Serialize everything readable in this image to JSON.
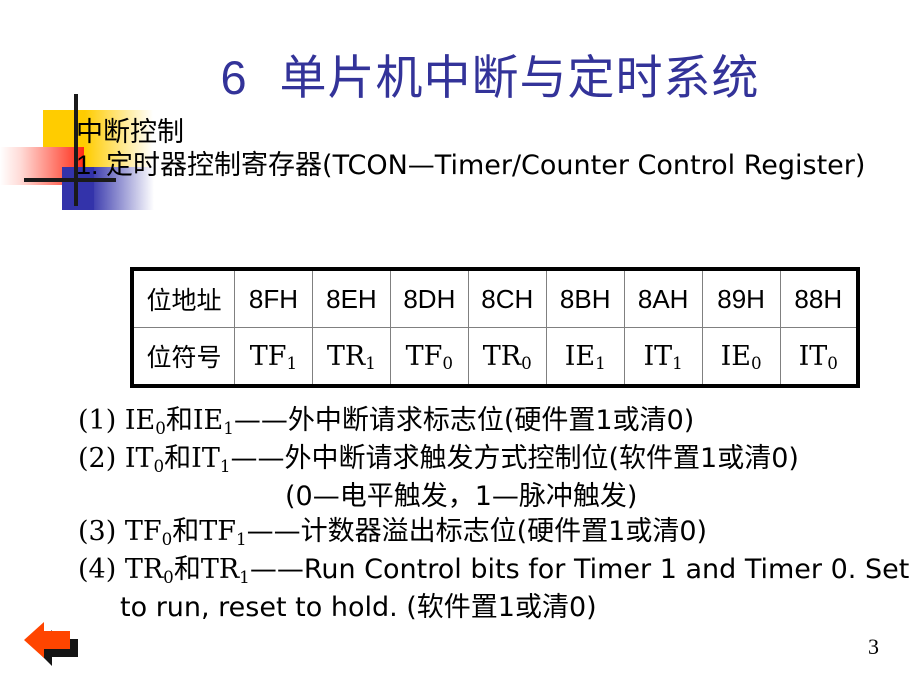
{
  "slide": {
    "title_number": "6",
    "title_text": "单片机中断与定时系统",
    "title_color": "#333399",
    "page_number": "3"
  },
  "heading": {
    "subheading": "中断控制",
    "item1_prefix": "1. ",
    "item1_text": "定时器控制寄存器(TCON—Timer/Counter Control Register)"
  },
  "table": {
    "row_label_address": "位地址",
    "row_label_symbol": "位符号",
    "addresses": [
      "8FH",
      "8EH",
      "8DH",
      "8CH",
      "8BH",
      "8AH",
      "89H",
      "88H"
    ],
    "symbols": [
      {
        "base": "TF",
        "sub": "1"
      },
      {
        "base": "TR",
        "sub": "1"
      },
      {
        "base": "TF",
        "sub": "0"
      },
      {
        "base": "TR",
        "sub": "0"
      },
      {
        "base": "IE",
        "sub": "1"
      },
      {
        "base": "IT",
        "sub": "1"
      },
      {
        "base": "IE",
        "sub": "0"
      },
      {
        "base": "IT",
        "sub": "0"
      }
    ]
  },
  "bullets": [
    {
      "id": "b1",
      "marker": "(1) ",
      "a_base": "IE",
      "a_sub": "0",
      "conj": "和",
      "b_base": "IE",
      "b_sub": "1",
      "desc": "——外中断请求标志位(硬件置1或清0)"
    },
    {
      "id": "b2",
      "marker": "(2) ",
      "a_base": "IT",
      "a_sub": "0",
      "conj": "和",
      "b_base": "IT",
      "b_sub": "1",
      "desc": "——外中断请求触发方式控制位(软件置1或清0)"
    },
    {
      "id": "b3",
      "note": "(0—电平触发，1—脉冲触发)"
    },
    {
      "id": "b4",
      "marker": "(3) ",
      "a_base": "TF",
      "a_sub": "0",
      "conj": "和",
      "b_base": "TF",
      "b_sub": "1",
      "desc": "——计数器溢出标志位(硬件置1或清0)"
    },
    {
      "id": "b5",
      "marker": "(4) ",
      "a_base": "TR",
      "a_sub": "0",
      "conj": "和",
      "b_base": "TR",
      "b_sub": "1",
      "desc": "——Run Control bits for Timer 1 and Timer 0. Set to run, reset to hold. (软件置1或清0)"
    }
  ],
  "decoration": {
    "arrow_icon": "back-arrow-icon",
    "arrow_color": "#FF4500",
    "arrow_shadow_color": "#000000",
    "yellow": "#FFCC00",
    "blue": "#3333AA",
    "red": "#FF2A15"
  }
}
